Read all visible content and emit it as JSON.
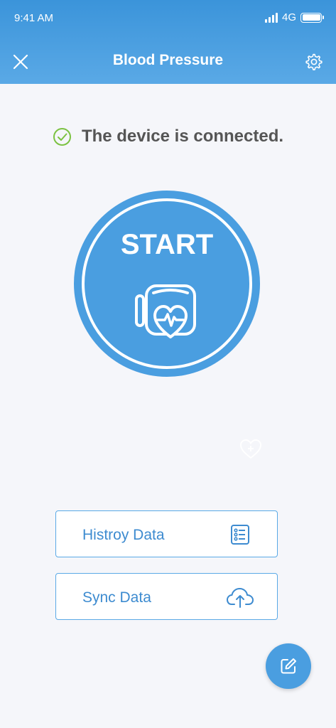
{
  "status_bar": {
    "time": "9:41 AM",
    "network": "4G"
  },
  "header": {
    "title": "Blood Pressure",
    "close_icon": "close-icon",
    "settings_icon": "gear-icon"
  },
  "connection": {
    "text": "The device is connected.",
    "icon": "check-circle-icon",
    "color": "#7cc242"
  },
  "start": {
    "label": "START",
    "icon": "blood-pressure-cuff-icon"
  },
  "actions": [
    {
      "label": "Histroy Data",
      "icon": "list-icon"
    },
    {
      "label": "Sync Data",
      "icon": "cloud-upload-icon"
    }
  ],
  "colors": {
    "primary": "#4a9ee0",
    "background": "#f5f6fa",
    "text": "#555555"
  }
}
